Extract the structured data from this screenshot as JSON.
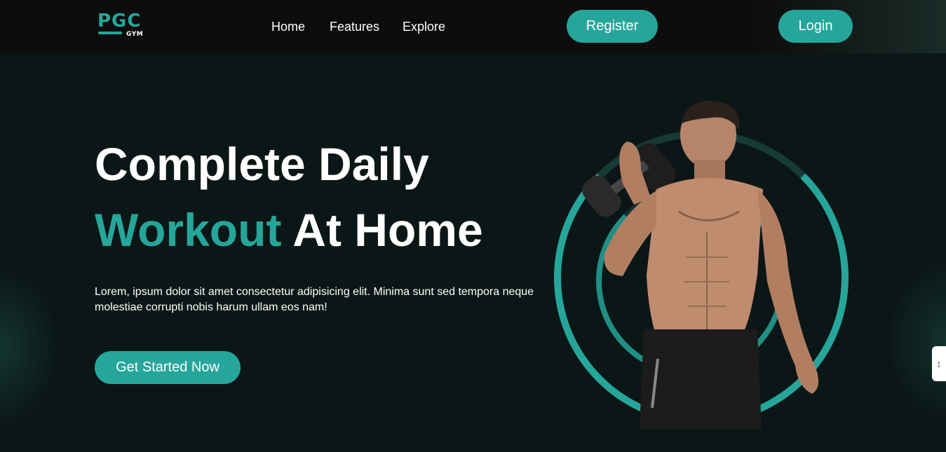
{
  "header": {
    "logo": {
      "letters": "PGC",
      "sub": "GYM"
    },
    "nav": [
      {
        "label": "Home"
      },
      {
        "label": "Features"
      },
      {
        "label": "Explore"
      }
    ],
    "register_label": "Register",
    "login_label": "Login"
  },
  "hero": {
    "headline_line1": "Complete Daily",
    "headline_accent": "Workout",
    "headline_line2_rest": " At Home",
    "description": "Lorem, ipsum dolor sit amet consectetur adipisicing elit. Minima sunt sed tempora neque molestiae corrupti nobis harum ullam eos nam!",
    "cta_label": "Get Started Now"
  },
  "colors": {
    "accent": "#26a69a",
    "background": "#0b1716",
    "nav_background": "#0d0d0d"
  },
  "icons": {
    "side_widget": "scroll-widget-icon"
  }
}
